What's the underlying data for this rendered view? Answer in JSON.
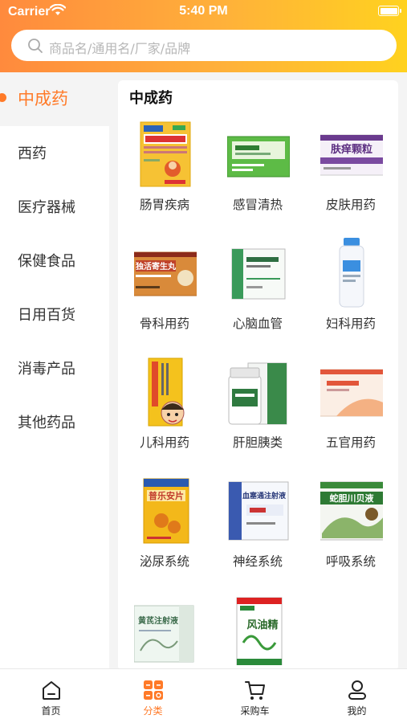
{
  "status_bar": {
    "carrier": "Carrier",
    "time": "5:40 PM"
  },
  "search": {
    "placeholder": "商品名/通用名/厂家/品牌"
  },
  "sidebar": {
    "items": [
      {
        "label": "中成药",
        "active": true
      },
      {
        "label": "西药"
      },
      {
        "label": "医疗器械"
      },
      {
        "label": "保健食品"
      },
      {
        "label": "日用百货"
      },
      {
        "label": "消毒产品"
      },
      {
        "label": "其他药品"
      }
    ]
  },
  "category": {
    "title": "中成药",
    "items": [
      {
        "label": "肠胃疾病"
      },
      {
        "label": "感冒清热"
      },
      {
        "label": "皮肤用药"
      },
      {
        "label": "骨科用药"
      },
      {
        "label": "心脑血管"
      },
      {
        "label": "妇科用药"
      },
      {
        "label": "儿科用药"
      },
      {
        "label": "肝胆胰类"
      },
      {
        "label": "五官用药"
      },
      {
        "label": "泌尿系统"
      },
      {
        "label": "神经系统"
      },
      {
        "label": "呼吸系统"
      },
      {
        "label": ""
      },
      {
        "label": ""
      }
    ],
    "box_text": {
      "p3": "肤痒颗粒",
      "p4": "独活寄生丸",
      "p10": "普乐安片",
      "p11": "血塞通注射液",
      "p12": "蛇胆川贝液",
      "p13": "黄芪注射液",
      "p14": "风油精"
    }
  },
  "tabbar": {
    "items": [
      {
        "label": "首页",
        "icon": "home-icon"
      },
      {
        "label": "分类",
        "icon": "category-icon",
        "active": true
      },
      {
        "label": "采购车",
        "icon": "cart-icon"
      },
      {
        "label": "我的",
        "icon": "user-icon"
      }
    ]
  },
  "colors": {
    "accent": "#ff7a28",
    "header_start": "#ff8a3d",
    "header_end": "#ffd21f",
    "background": "#f4f4f4"
  }
}
